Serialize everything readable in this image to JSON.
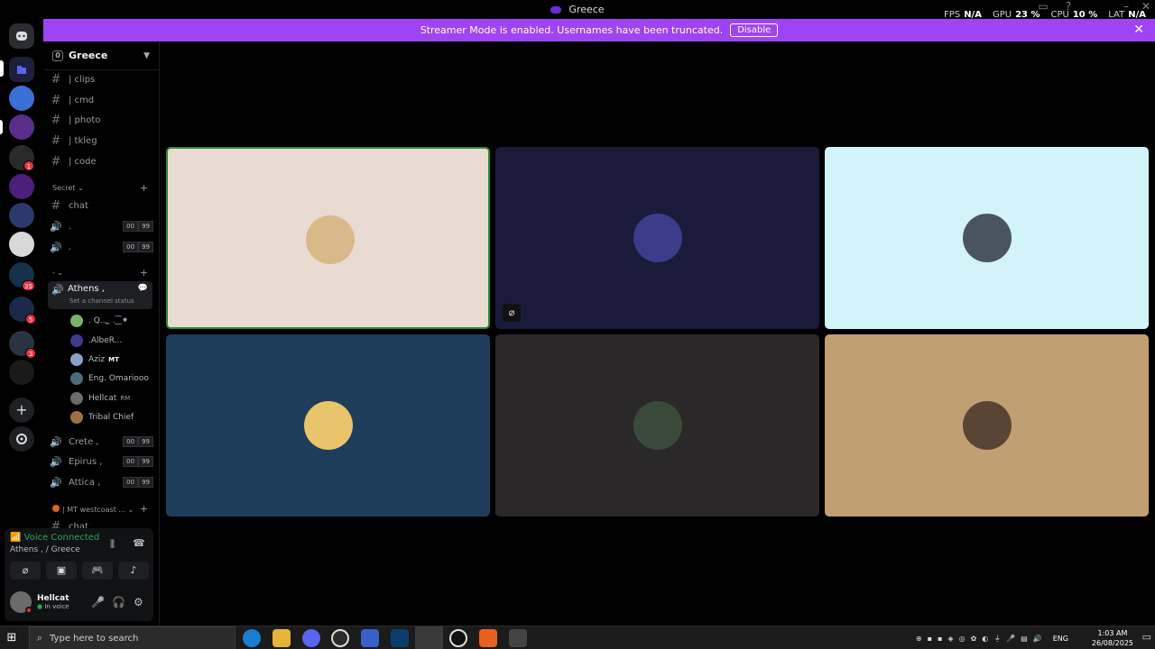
{
  "window": {
    "title": "Greece"
  },
  "overlay": {
    "fps_label": "FPS",
    "fps_value": "N/A",
    "gpu_label": "GPU",
    "gpu_value": "23 %",
    "cpu_label": "CPU",
    "cpu_value": "10 %",
    "lat_label": "LAT",
    "lat_value": "N/A"
  },
  "banner": {
    "text": "Streamer Mode is enabled. Usernames have been truncated.",
    "disable_label": "Disable"
  },
  "rail": {
    "badges": [
      "1",
      "35",
      "5",
      "3"
    ]
  },
  "sidebar": {
    "server_name": "Greece",
    "text_channels": [
      "| clips",
      "| cmd",
      "| photo",
      "| tkleg",
      "| code"
    ],
    "category_secret": "Secret",
    "secret_channels": [
      {
        "name": "chat",
        "type": "text"
      },
      {
        "name": ".",
        "type": "voice",
        "counter": [
          "00",
          "99"
        ]
      },
      {
        "name": ".",
        "type": "voice",
        "counter": [
          "00",
          "99"
        ]
      }
    ],
    "category_dash": "-",
    "active_voice": {
      "name": "Athens ,",
      "status_hint": "Set a channel status"
    },
    "members": [
      {
        "name": ". Q..؂ .⁐⁕",
        "color": "#7fb069"
      },
      {
        "name": ".AlbeR...",
        "color": "#3d3a8f"
      },
      {
        "name": "Aziz",
        "tag": "MT",
        "color": "#8aa0c8"
      },
      {
        "name": "Eng. Omariooo",
        "color": "#4f6a7d"
      },
      {
        "name": "Hellcat",
        "tag": "RM",
        "color": "#6b6b6b"
      },
      {
        "name": "Tribal Chief",
        "color": "#a07040"
      }
    ],
    "other_voice": [
      {
        "name": "Crete ,",
        "counter": [
          "00",
          "99"
        ]
      },
      {
        "name": "Epirus ,",
        "counter": [
          "00",
          "99"
        ]
      },
      {
        "name": "Attica ,",
        "counter": [
          "00",
          "99"
        ]
      }
    ],
    "category_westcoast": "| MT westcoast ...",
    "partial_channel": "chat"
  },
  "voice_panel": {
    "title": "Voice Connected",
    "subtitle": "Athens , / Greece",
    "user_name": "Hellcat",
    "user_status": "In voice"
  },
  "tiles": [
    {
      "bg": "#e8dcd2",
      "avatar": "#d9b98a",
      "speaking": true,
      "camera_off_icon": false
    },
    {
      "bg": "#1b1a3a",
      "avatar": "#3b3d8a",
      "speaking": false,
      "camera_off_icon": true
    },
    {
      "bg": "#d2f3fa",
      "avatar": "#4a5560",
      "speaking": false,
      "camera_off_icon": false
    },
    {
      "bg": "#1d3d5a",
      "avatar": "#e9c46a",
      "speaking": false,
      "camera_off_icon": false
    },
    {
      "bg": "#2b2829",
      "avatar": "#3a4a3a",
      "speaking": false,
      "camera_off_icon": false
    },
    {
      "bg": "#c09f73",
      "avatar": "#5a4535",
      "speaking": false,
      "camera_off_icon": false
    }
  ],
  "taskbar": {
    "search_placeholder": "Type here to search",
    "lang": "ENG",
    "time": "1:03 AM",
    "date": "26/08/2025"
  }
}
